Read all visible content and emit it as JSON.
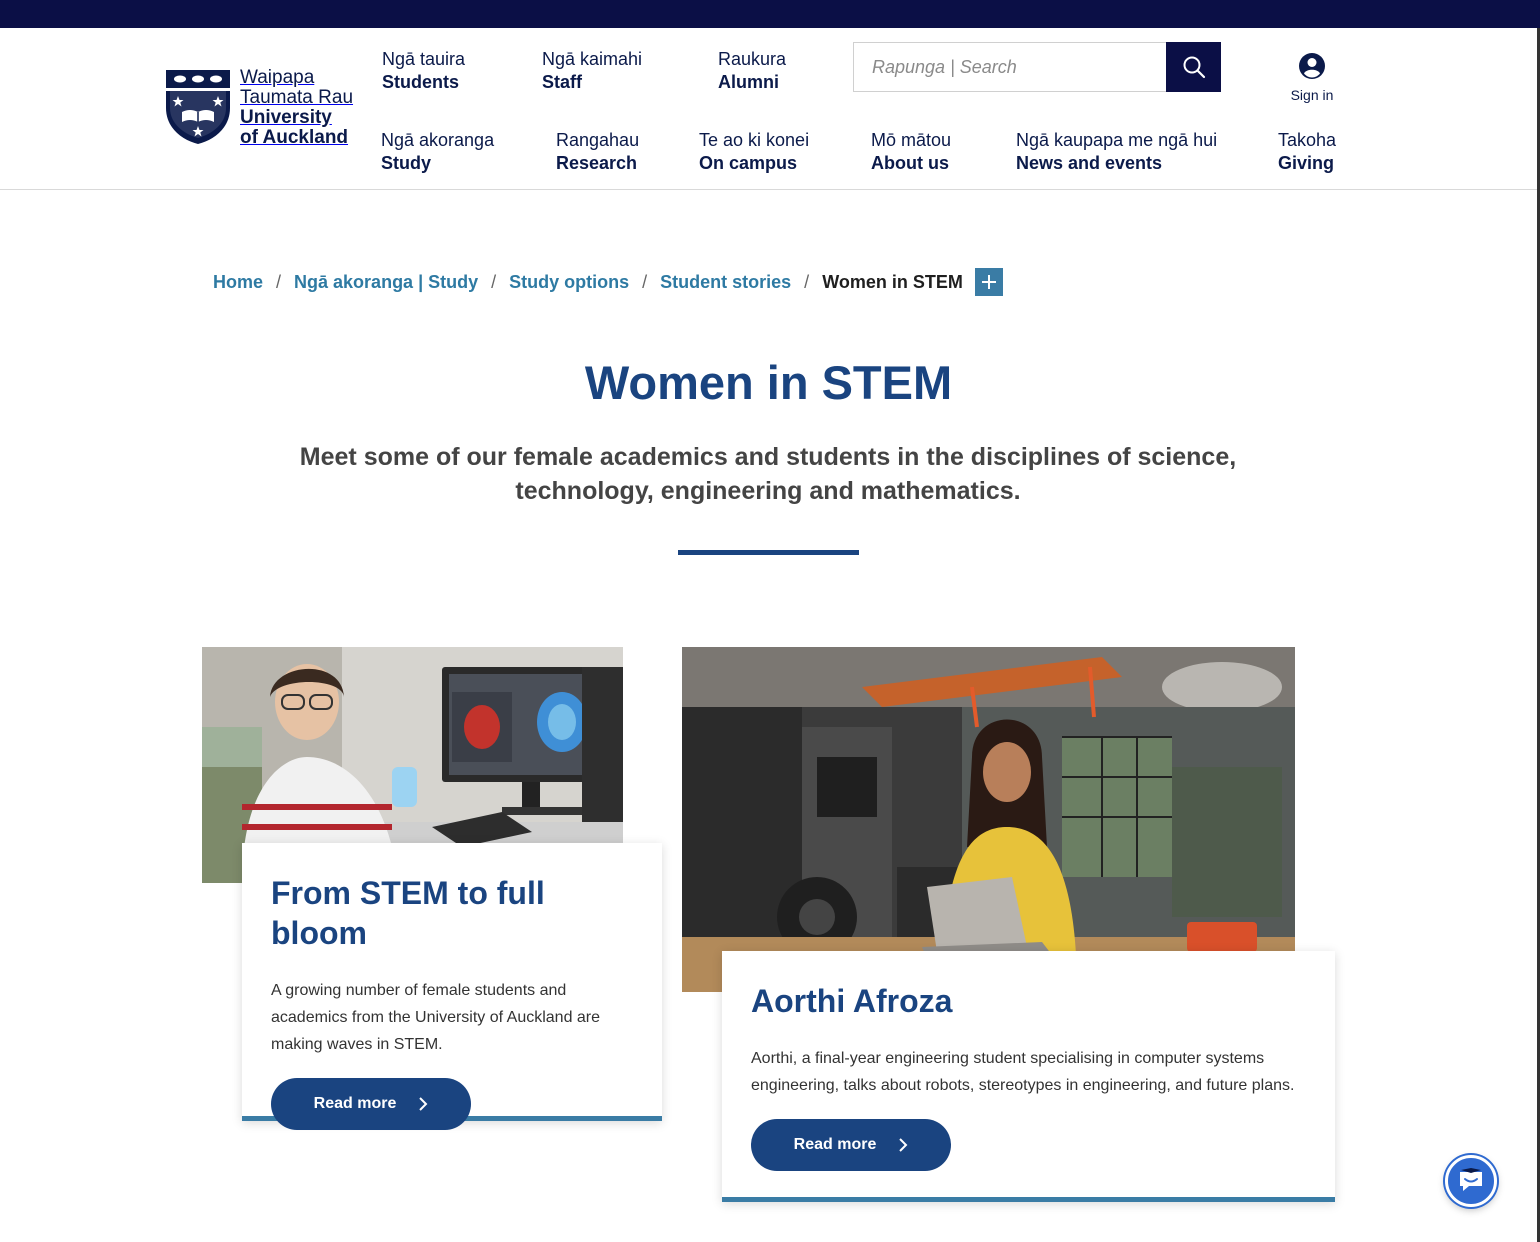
{
  "brand": {
    "line1": "Waipapa",
    "line2": "Taumata Rau",
    "line3": "University",
    "line4": "of Auckland"
  },
  "top_nav": [
    {
      "mi": "Ngā tauira",
      "en": "Students"
    },
    {
      "mi": "Ngā kaimahi",
      "en": "Staff"
    },
    {
      "mi": "Raukura",
      "en": "Alumni"
    }
  ],
  "main_nav": [
    {
      "mi": "Ngā akoranga",
      "en": "Study"
    },
    {
      "mi": "Rangahau",
      "en": "Research"
    },
    {
      "mi": "Te ao ki konei",
      "en": "On campus"
    },
    {
      "mi": "Mō mātou",
      "en": "About us"
    },
    {
      "mi": "Ngā kaupapa me ngā hui",
      "en": "News and events"
    },
    {
      "mi": "Takoha",
      "en": "Giving"
    }
  ],
  "search": {
    "placeholder": "Rapunga | Search",
    "value": ""
  },
  "signin": {
    "label": "Sign in"
  },
  "breadcrumb": {
    "items": [
      "Home",
      "Ngā akoranga | Study",
      "Study options",
      "Student stories"
    ],
    "current": "Women in STEM",
    "separator": "/"
  },
  "page": {
    "title": "Women in STEM",
    "intro": "Meet some of our female academics and students in the disciplines of science, technology, engineering and mathematics."
  },
  "cards": [
    {
      "title": "From STEM to full bloom",
      "text": "A growing number of female students and academics from the University of Auckland are making waves in STEM.",
      "button": "Read more"
    },
    {
      "title": "Aorthi Afroza",
      "text": "Aorthi, a final-year engineering student specialising in computer systems engineering, talks about robots, stereotypes in engineering, and future plans.",
      "button": "Read more"
    }
  ],
  "colors": {
    "top_bar": "#0b0f46",
    "heading_blue": "#1a4480",
    "link_blue": "#2e7aa3",
    "accent": "#3a7ca5"
  }
}
